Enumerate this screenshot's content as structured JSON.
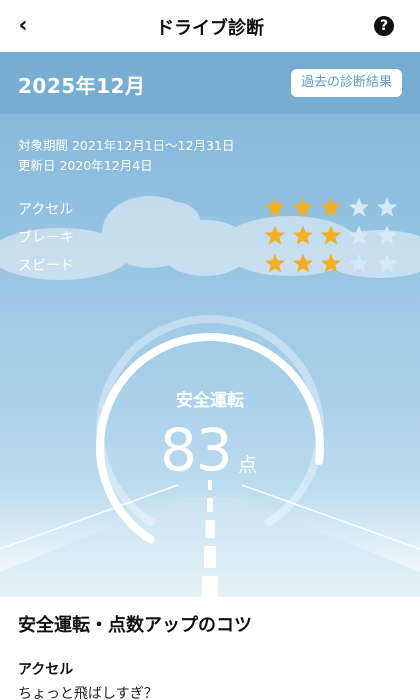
{
  "header": {
    "back_icon": "‹",
    "title": "ドライブ診断",
    "help_icon": "?"
  },
  "summary": {
    "month": "2025年12月",
    "history_button": "過去の診断結果",
    "period": "対象期間 2021年12月1日〜12月31日",
    "updated": "更新日 2020年12月4日"
  },
  "ratings": [
    {
      "label": "アクセル",
      "stars": 3,
      "max": 5
    },
    {
      "label": "ブレーキ",
      "stars": 3,
      "max": 5
    },
    {
      "label": "スピード",
      "stars": 3,
      "max": 5
    }
  ],
  "score": {
    "label": "安全運転",
    "value": "83",
    "unit": "点",
    "percent": 83
  },
  "tips": {
    "title": "安全運転・点数アップのコツ",
    "items": [
      {
        "heading": "アクセル",
        "text": "ちょっと飛ばしすぎ？"
      }
    ]
  },
  "colors": {
    "star_filled": "#f2b124",
    "star_empty": "#d6e9f4",
    "sky_top": "#7fb3d6",
    "history_text": "#5d9ec9"
  }
}
